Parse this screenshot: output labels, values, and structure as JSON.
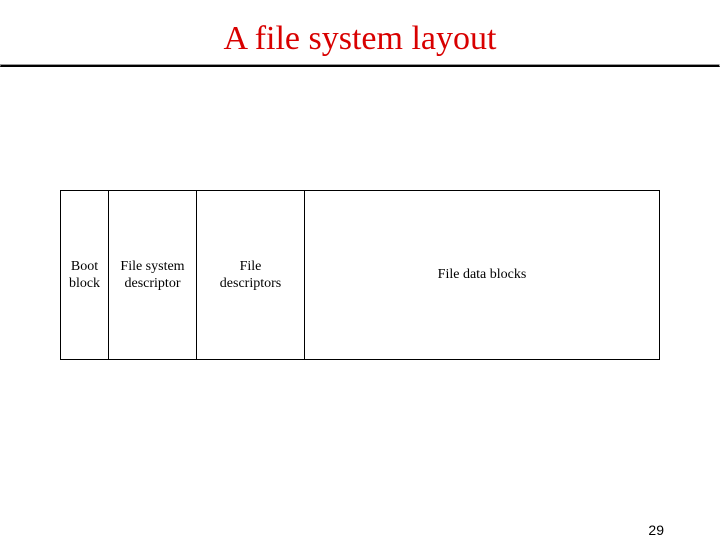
{
  "title": "A file system layout",
  "diagram": {
    "cells": {
      "boot": "Boot\nblock",
      "fs_descriptor": "File system\ndescriptor",
      "file_descriptors": "File\ndescriptors",
      "data_blocks": "File data blocks"
    }
  },
  "page_number": "29"
}
